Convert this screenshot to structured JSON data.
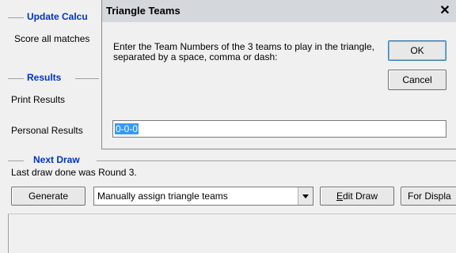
{
  "main": {
    "update_heading": "Update Calcu",
    "score_all_label": "Score all matches",
    "results_heading": "Results",
    "print_results_label": "Print Results",
    "personal_results_label": "Personal Results",
    "next_draw_heading": "Next Draw",
    "last_draw_text": "Last draw done was Round 3.",
    "generate_button": "Generate",
    "draw_option_selected": "Manually assign triangle teams",
    "edit_draw_prefix": "E",
    "edit_draw_rest": "dit Draw",
    "for_display_button": "For Displa"
  },
  "dialog": {
    "title": "Triangle Teams",
    "close_glyph": "✕",
    "prompt": "Enter the Team Numbers of the 3 teams to play in the triangle, separated by a space, comma or dash:",
    "ok_button": "OK",
    "cancel_button": "Cancel",
    "input_value": "0-0-0"
  },
  "colors": {
    "heading_blue": "#0033cc",
    "selection_blue": "#3399ff"
  }
}
